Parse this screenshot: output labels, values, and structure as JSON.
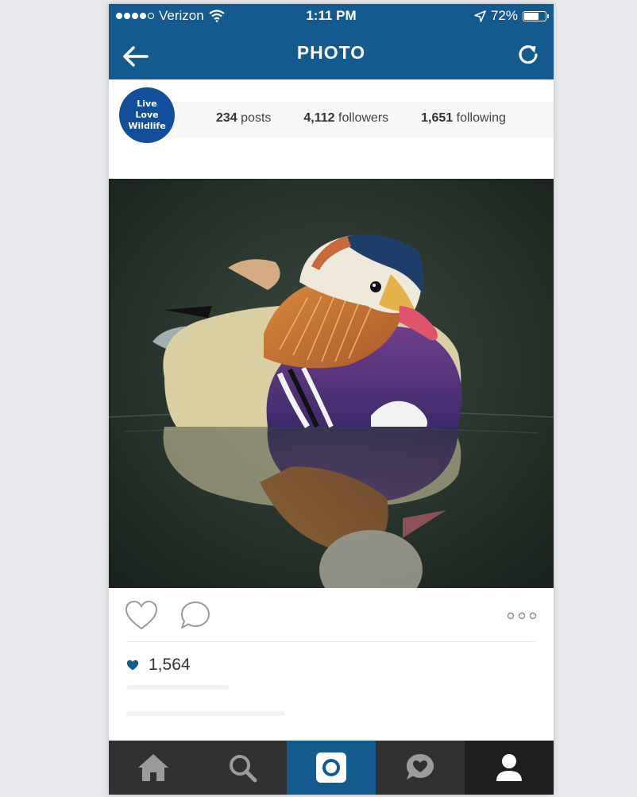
{
  "status_bar": {
    "carrier": "Verizon",
    "time": "1:11 PM",
    "battery_percent": "72%",
    "battery_level": 0.72,
    "signal_dots_filled": 4,
    "icons": [
      "wifi-icon",
      "location-arrow-icon",
      "battery-icon"
    ]
  },
  "header": {
    "title": "PHOTO",
    "back_icon": "back-arrow-icon",
    "refresh_icon": "refresh-icon"
  },
  "profile": {
    "avatar_lines": [
      "Live",
      "Love",
      "Wildlife"
    ],
    "avatar_color": "#124f9a",
    "posts_count": "234",
    "posts_label": "posts",
    "followers_count": "4,112",
    "followers_label": "followers",
    "following_count": "1,651",
    "following_label": "following"
  },
  "post": {
    "likes_count": "1,564",
    "icons": [
      "heart-outline-icon",
      "comment-bubble-icon",
      "more-dots-icon",
      "heart-filled-icon"
    ]
  },
  "tab_bar": {
    "tabs": [
      {
        "name": "home",
        "icon": "home-icon"
      },
      {
        "name": "search",
        "icon": "search-icon"
      },
      {
        "name": "camera",
        "icon": "camera-icon",
        "active": true
      },
      {
        "name": "activity",
        "icon": "activity-heart-icon"
      },
      {
        "name": "profile",
        "icon": "profile-icon"
      }
    ]
  },
  "colors": {
    "brand_blue": "#135a8f",
    "tab_bar": "#313131",
    "heart": "#135a8f"
  }
}
